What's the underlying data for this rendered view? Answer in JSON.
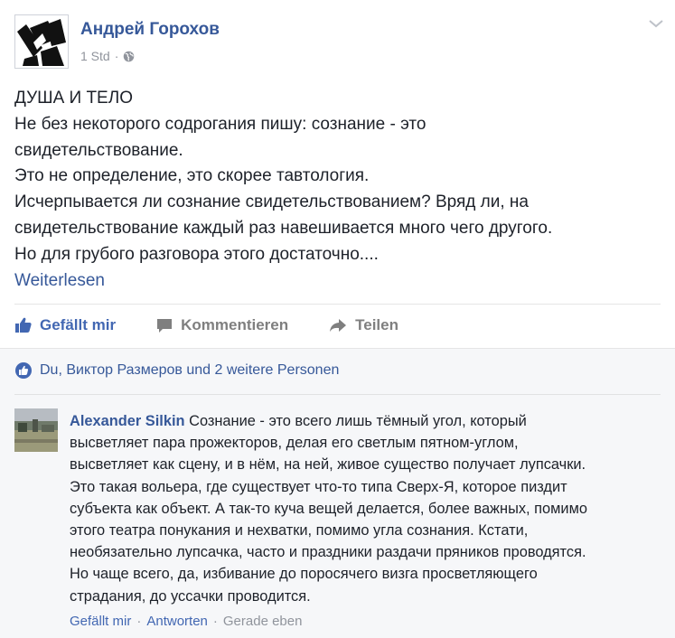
{
  "post": {
    "author": "Андрей Горохов",
    "time": "1 Std",
    "meta_dot": "·",
    "body_lines": [
      "ДУША И ТЕЛО",
      "Не без некоторого содрогания пишу: сознание - это",
      "свидетельствование.",
      "Это не определение, это скорее тавтология.",
      "Исчерпывается ли сознание свидетельствованием? Вряд ли, на",
      "свидетельствование каждый раз навешивается много чего другого.",
      "Но для грубого разговора этого достаточно...."
    ],
    "read_more": "Weiterlesen"
  },
  "actions": {
    "like": "Gefällt mir",
    "comment": "Kommentieren",
    "share": "Teilen"
  },
  "likes_summary": "Du, Виктор Размеров und 2 weitere Personen",
  "comment": {
    "author": "Alexander Silkin",
    "first_line_rest": " Сознание - это всего лишь тёмный угол, который",
    "lines": [
      "высветляет пара прожекторов, делая его светлым пятном-углом,",
      "высветляет как сцену, и в нём, на ней, живое существо получает лупсачки.",
      "Это такая вольера, где существует что-то типа Сверх-Я, которое пиздит",
      "субъекта как объект. А так-то куча вещей делается, более важных, помимо",
      "этого театра понукания и нехватки, помимо угла сознания. Кстати,",
      "необязательно лупсачка, часто и праздники раздачи пряников проводятся.",
      "Но чаще всего, да, избивание до поросячего визга просветляющего",
      "страдания, до уссачки проводится."
    ],
    "like": "Gefällt mir",
    "reply": "Antworten",
    "time": "Gerade eben",
    "sep": "·"
  },
  "colors": {
    "link": "#365899",
    "like_blue": "#4267b2",
    "text": "#1d2129",
    "muted": "#90949c",
    "ufi_bg": "#f6f7f9"
  },
  "icons": {
    "globe": "globe-icon",
    "chevron": "chevron-down-icon",
    "like": "thumbs-up-icon",
    "comment": "comment-icon",
    "share": "share-arrow-icon"
  }
}
